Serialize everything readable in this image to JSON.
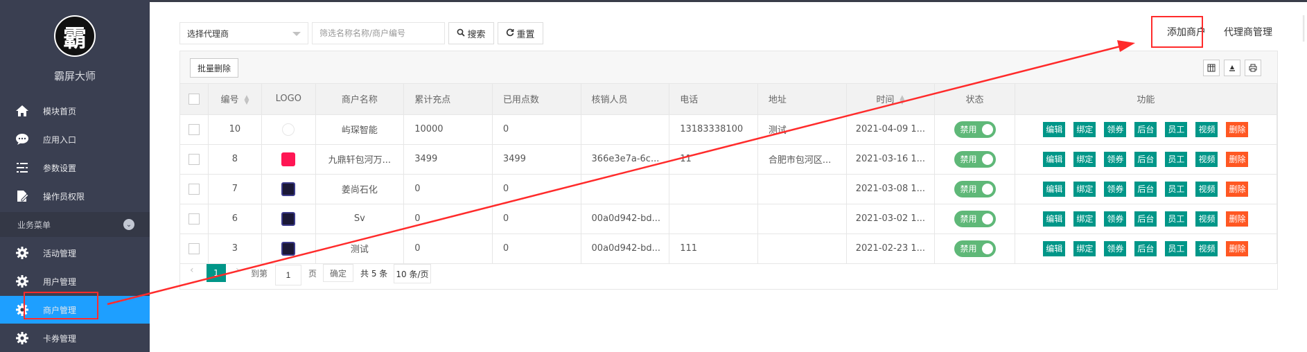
{
  "sidebar": {
    "logo_char": "霸",
    "brand": "霸屏大师",
    "items": [
      {
        "label": "模块首页",
        "icon": "home-icon"
      },
      {
        "label": "应用入口",
        "icon": "chat-icon"
      },
      {
        "label": "参数设置",
        "icon": "list-settings-icon"
      },
      {
        "label": "操作员权限",
        "icon": "document-edit-icon"
      }
    ],
    "group_title": "业务菜单",
    "group_items": [
      {
        "label": "活动管理",
        "icon": "gear-icon"
      },
      {
        "label": "用户管理",
        "icon": "gear-icon"
      },
      {
        "label": "商户管理",
        "icon": "gear-icon",
        "active": true
      },
      {
        "label": "卡券管理",
        "icon": "gear-icon"
      }
    ]
  },
  "toolbar": {
    "agent_select": "选择代理商",
    "search_placeholder": "筛选名称名称/商户编号",
    "search_label": "搜索",
    "reset_label": "重置",
    "add_merchant": "添加商户",
    "agent_management": "代理商管理"
  },
  "table": {
    "batch_delete": "批量删除",
    "headers": [
      "编号",
      "LOGO",
      "商户名称",
      "累计充点",
      "已用点数",
      "核销人员",
      "电话",
      "地址",
      "时间",
      "状态",
      "功能"
    ],
    "rows": [
      {
        "id": "10",
        "logo": "blank",
        "name": "屿琛智能",
        "charged": "10000",
        "used": "0",
        "staff": "",
        "phone": "13183338100",
        "address": "测试",
        "time": "2021-04-09 1...",
        "status": "禁用"
      },
      {
        "id": "8",
        "logo": "pink",
        "name": "九鼎轩包河万...",
        "charged": "3499",
        "used": "3499",
        "staff": "366e3e7a-6c...",
        "phone": "11",
        "address": "合肥市包河区...",
        "time": "2021-03-16 1...",
        "status": "禁用"
      },
      {
        "id": "7",
        "logo": "dark",
        "name": "姜尚石化",
        "charged": "0",
        "used": "0",
        "staff": "",
        "phone": "",
        "address": "",
        "time": "2021-03-08 1...",
        "status": "禁用"
      },
      {
        "id": "6",
        "logo": "dark",
        "name": "Sv",
        "charged": "0",
        "used": "0",
        "staff": "00a0d942-bd...",
        "phone": "",
        "address": "",
        "time": "2021-03-02 1...",
        "status": "禁用"
      },
      {
        "id": "3",
        "logo": "dark",
        "name": "测试",
        "charged": "0",
        "used": "0",
        "staff": "00a0d942-bd...",
        "phone": "111",
        "address": "",
        "time": "2021-02-23 1...",
        "status": "禁用"
      }
    ],
    "actions": [
      "编辑",
      "绑定",
      "领券",
      "后台",
      "员工",
      "视频",
      "删除"
    ]
  },
  "pagination": {
    "current": "1",
    "goto": "到第",
    "page_input": "1",
    "page_unit": "页",
    "confirm": "确定",
    "total": "共 5 条",
    "page_size": "10 条/页"
  },
  "colors": {
    "sidebar_bg": "#3a3f51",
    "active_menu": "#1e9fff",
    "primary": "#009688",
    "danger": "#ff5722",
    "toggle": "#5fb878",
    "annotation": "#ff2b2b"
  }
}
